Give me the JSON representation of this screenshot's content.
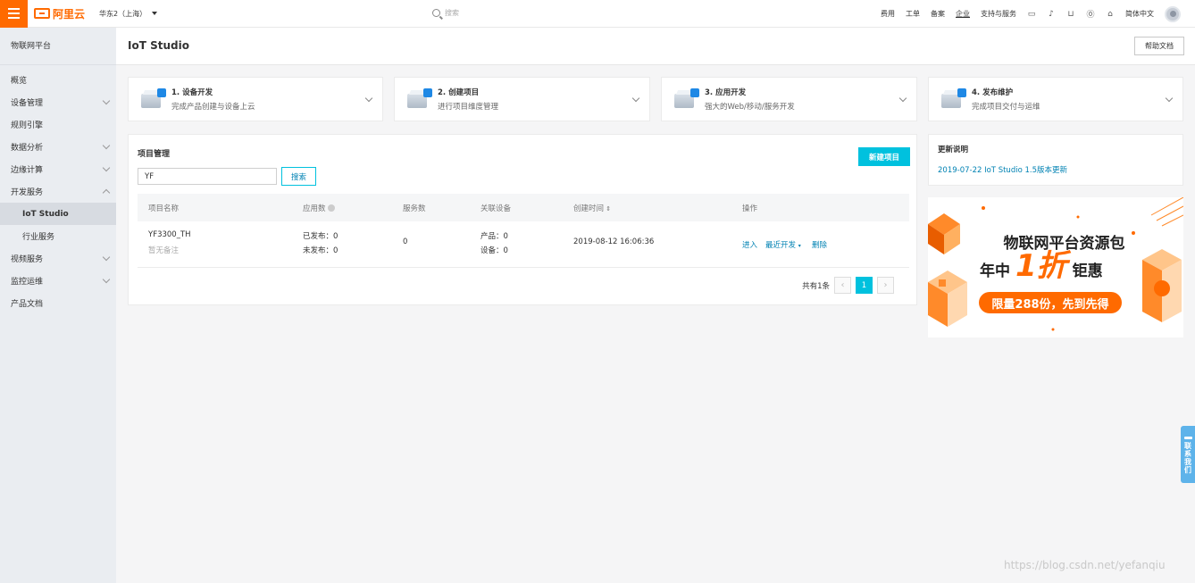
{
  "topbar": {
    "logo_text": "阿里云",
    "region": "华东2（上海）",
    "search_placeholder": "搜索",
    "menu": [
      "费用",
      "工单",
      "备案",
      "企业",
      "支持与服务"
    ],
    "lang": "简体中文"
  },
  "sidebar": {
    "title": "物联网平台",
    "items": [
      {
        "label": "概览",
        "chevron": "none"
      },
      {
        "label": "设备管理",
        "chevron": "down"
      },
      {
        "label": "规则引擎",
        "chevron": "none"
      },
      {
        "label": "数据分析",
        "chevron": "down"
      },
      {
        "label": "边缘计算",
        "chevron": "down"
      },
      {
        "label": "开发服务",
        "chevron": "up"
      },
      {
        "label": "IoT Studio",
        "chevron": "none"
      },
      {
        "label": "行业服务",
        "chevron": "none"
      },
      {
        "label": "视频服务",
        "chevron": "down"
      },
      {
        "label": "监控运维",
        "chevron": "down"
      },
      {
        "label": "产品文档",
        "chevron": "none"
      }
    ]
  },
  "header": {
    "title": "IoT Studio",
    "help_label": "帮助文档"
  },
  "steps": [
    {
      "title": "1. 设备开发",
      "desc": "完成产品创建与设备上云"
    },
    {
      "title": "2. 创建项目",
      "desc": "进行项目维度管理"
    },
    {
      "title": "3. 应用开发",
      "desc": "强大的Web/移动/服务开发"
    },
    {
      "title": "4. 发布维护",
      "desc": "完成项目交付与运维"
    }
  ],
  "projects": {
    "title": "项目管理",
    "new_label": "新建项目",
    "search_value": "YF",
    "search_label": "搜索",
    "columns": [
      "项目名称",
      "应用数",
      "服务数",
      "关联设备",
      "创建时间",
      "操作"
    ],
    "rows": [
      {
        "name": "YF3300_TH",
        "note": "暂无备注",
        "apps_published": "已发布：0",
        "apps_unpublished": "未发布：0",
        "services": "0",
        "devices_product": "产品：0",
        "devices_device": "设备：0",
        "created": "2019-08-12 16:06:36",
        "actions": [
          "进入",
          "最近开发",
          "删除"
        ]
      }
    ],
    "total": "共有1条",
    "page": "1"
  },
  "update": {
    "title": "更新说明",
    "link": "2019-07-22 IoT Studio 1.5版本更新"
  },
  "banner": {
    "line1": "物联网平台资源包",
    "line2_prefix": "年中",
    "line2_big": "1折",
    "line2_suffix": "钜惠",
    "pill": "限量288份，先到先得"
  },
  "contact": [
    "联",
    "系",
    "我",
    "们"
  ],
  "watermark": "https://blog.csdn.net/yefanqiu",
  "colors": {
    "brand": "#ff6a00",
    "accent": "#00c1de",
    "link": "#0082b3"
  }
}
